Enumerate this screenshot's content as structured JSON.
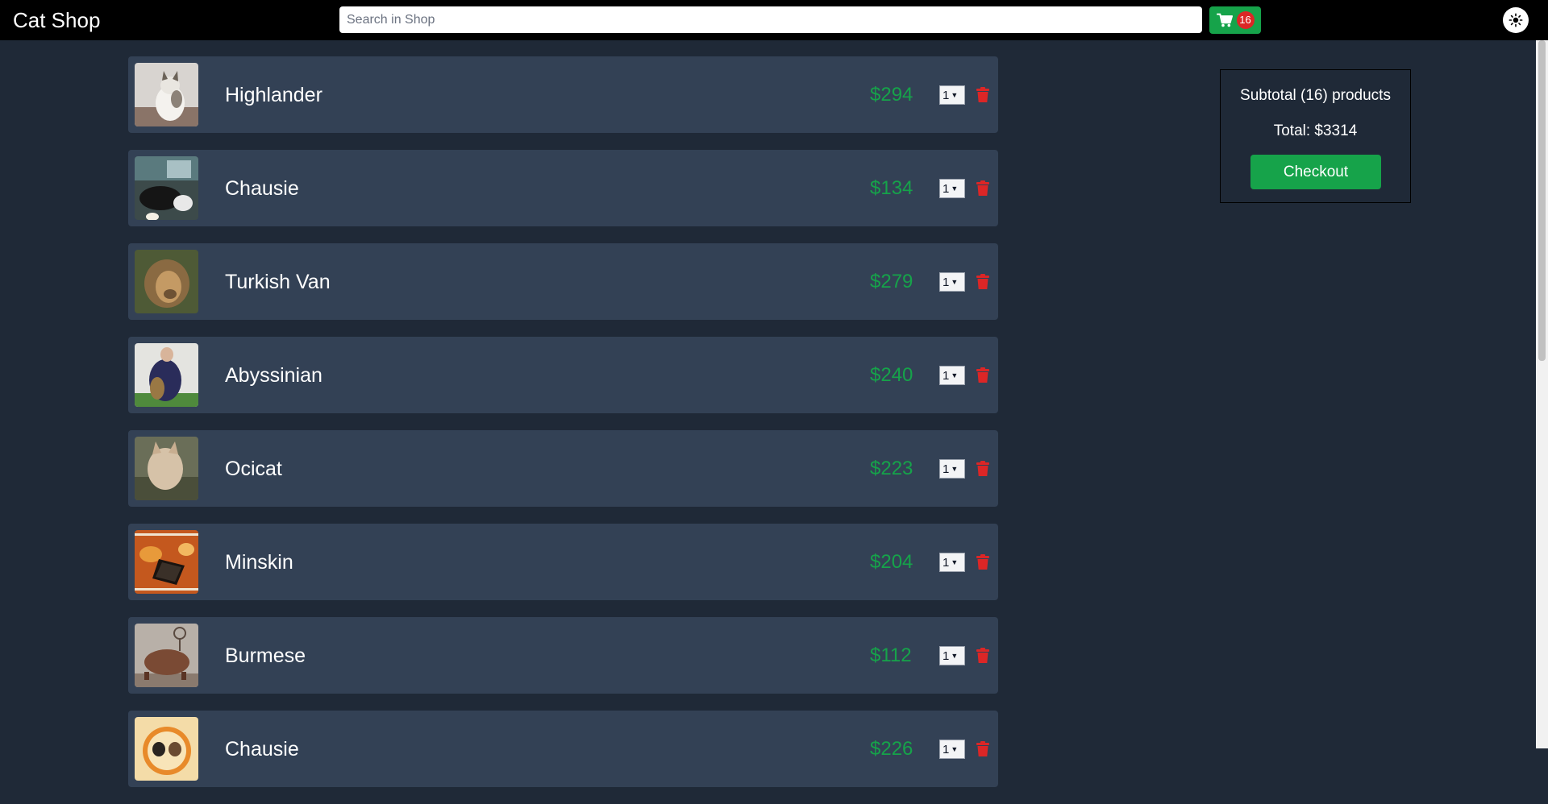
{
  "header": {
    "brand": "Cat Shop",
    "search_placeholder": "Search in Shop",
    "cart_count": "16"
  },
  "cart": {
    "items": [
      {
        "name": "Highlander",
        "price": "$294",
        "qty": "1"
      },
      {
        "name": "Chausie",
        "price": "$134",
        "qty": "1"
      },
      {
        "name": "Turkish Van",
        "price": "$279",
        "qty": "1"
      },
      {
        "name": "Abyssinian",
        "price": "$240",
        "qty": "1"
      },
      {
        "name": "Ocicat",
        "price": "$223",
        "qty": "1"
      },
      {
        "name": "Minskin",
        "price": "$204",
        "qty": "1"
      },
      {
        "name": "Burmese",
        "price": "$112",
        "qty": "1"
      },
      {
        "name": "Chausie",
        "price": "$226",
        "qty": "1"
      }
    ]
  },
  "summary": {
    "subtotal": "Subtotal (16) products",
    "total": "Total: $3314",
    "checkout_label": "Checkout"
  },
  "colors": {
    "page_bg": "#1f2937",
    "card_bg": "#334155",
    "accent_green": "#16a34a",
    "danger_red": "#dc2626"
  }
}
